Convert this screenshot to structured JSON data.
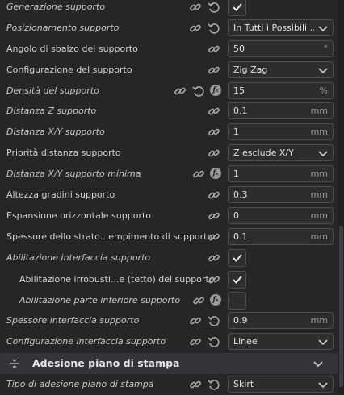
{
  "settings": [
    {
      "label": "Generazione supporto",
      "italic": true,
      "icons": [
        "link",
        "reset"
      ],
      "control": "check",
      "checked": true
    },
    {
      "label": "Posizionamento supporto",
      "italic": true,
      "icons": [
        "link",
        "reset"
      ],
      "control": "select",
      "value": "In Tutti i Possibili ..."
    },
    {
      "label": "Angolo di sbalzo del supporto",
      "italic": false,
      "icons": [
        "link"
      ],
      "control": "number",
      "value": "50",
      "unit": "°"
    },
    {
      "label": "Configurazione del supporto",
      "italic": false,
      "icons": [
        "link"
      ],
      "control": "select",
      "value": "Zig Zag"
    },
    {
      "label": "Densità del supporto",
      "italic": true,
      "icons": [
        "link",
        "reset",
        "fx"
      ],
      "control": "number",
      "value": "15",
      "unit": "%"
    },
    {
      "label": "Distanza Z supporto",
      "italic": true,
      "icons": [
        "link"
      ],
      "control": "number",
      "value": "0.1",
      "unit": "mm"
    },
    {
      "label": "Distanza X/Y supporto",
      "italic": true,
      "icons": [
        "link"
      ],
      "control": "number",
      "value": "1",
      "unit": "mm"
    },
    {
      "label": "Priorità distanza supporto",
      "italic": false,
      "icons": [
        "link"
      ],
      "control": "select",
      "value": "Z esclude X/Y"
    },
    {
      "label": "Distanza X/Y supporto minima",
      "italic": true,
      "icons": [
        "link",
        "fx"
      ],
      "control": "number",
      "value": "1",
      "unit": "mm"
    },
    {
      "label": "Altezza gradini supporto",
      "italic": false,
      "icons": [
        "link"
      ],
      "control": "number",
      "value": "0.3",
      "unit": "mm"
    },
    {
      "label": "Espansione orizzontale supporto",
      "italic": false,
      "icons": [
        "link"
      ],
      "control": "number",
      "value": "0",
      "unit": "mm"
    },
    {
      "label": "Spessore dello strato...empimento di supporto",
      "italic": false,
      "icons": [
        "link"
      ],
      "control": "number",
      "value": "0.1",
      "unit": "mm"
    },
    {
      "label": "Abilitazione interfaccia supporto",
      "italic": true,
      "icons": [
        "link"
      ],
      "control": "check",
      "checked": true
    },
    {
      "label": "Abilitazione irrobusti...e (tetto) del supporto",
      "italic": false,
      "indent": true,
      "icons": [
        "link"
      ],
      "control": "check",
      "checked": true
    },
    {
      "label": "Abilitazione parte inferiore supporto",
      "italic": true,
      "indent": true,
      "icons": [
        "link",
        "fx"
      ],
      "control": "check",
      "checked": false
    },
    {
      "label": "Spessore interfaccia supporto",
      "italic": true,
      "icons": [
        "link",
        "reset"
      ],
      "control": "number",
      "value": "0.9",
      "unit": "mm"
    },
    {
      "label": "Configurazione interfaccia supporto",
      "italic": true,
      "icons": [
        "link",
        "reset"
      ],
      "control": "select",
      "value": "Linee"
    }
  ],
  "section": {
    "title": "Adesione piano di stampa",
    "icon": "adhesion-icon"
  },
  "after_section": [
    {
      "label": "Tipo di adesione piano di stampa",
      "italic": true,
      "icons": [
        "link",
        "reset"
      ],
      "control": "select",
      "value": "Skirt"
    }
  ],
  "colors": {
    "background": "#242628",
    "section": "#333538",
    "control_border": "#4c4e51"
  }
}
